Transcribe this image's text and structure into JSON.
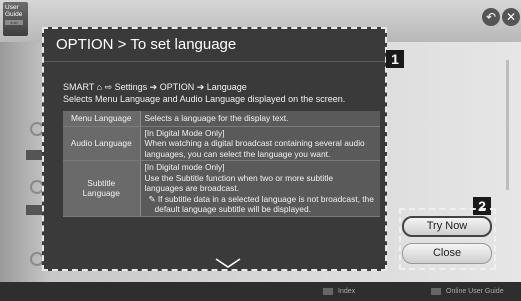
{
  "guide_badge": {
    "line1": "User",
    "line2": "Guide",
    "small": "e-m"
  },
  "top_buttons": {
    "back_glyph": "↶",
    "close_glyph": "✕"
  },
  "dialog": {
    "title": "OPTION > To set language",
    "path": "SMART ⌂ ⇨ Settings ➔ OPTION ➔ Language",
    "description": "Selects Menu Language and Audio Language displayed on the screen.",
    "rows": [
      {
        "key": "Menu Language",
        "lines": [
          "Selects a language for the display text."
        ]
      },
      {
        "key": "Audio Language",
        "lines": [
          "[In Digital Mode Only]",
          "When watching a digital broadcast containing several audio",
          "languages, you can select the language you want."
        ]
      },
      {
        "key_lines": [
          "Subtitle",
          "Language"
        ],
        "lines": [
          "[In Digital mode Only]",
          "Use the Subtitle function when two or more subtitle",
          "languages are broadcast."
        ],
        "note": "✎ If subtitle data in a selected language is not broadcast, the default language subtitle will be displayed."
      }
    ]
  },
  "markers": {
    "one": "1",
    "two": "2"
  },
  "side_buttons": {
    "try_now": "Try Now",
    "close": "Close"
  },
  "footer": {
    "index": "Index",
    "online": "Online User Guide"
  },
  "colors": {
    "dialog_bg": "#3a3a3a",
    "key_cell": "#6a6a6a",
    "value_cell": "#5a5a5a"
  }
}
